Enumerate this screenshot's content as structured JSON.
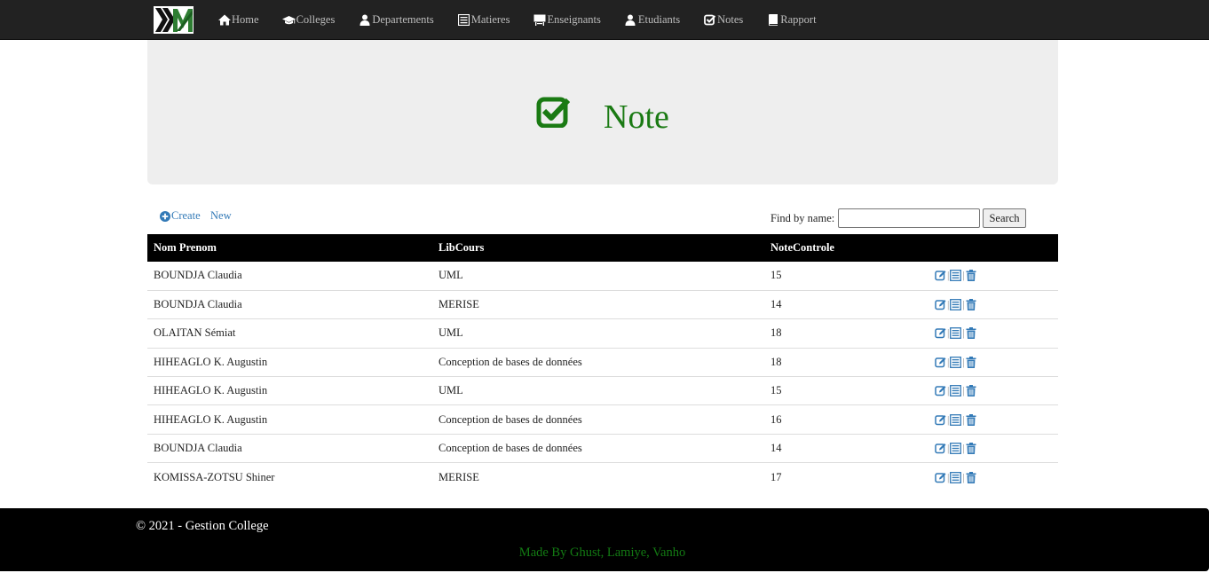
{
  "brand": {
    "alt": "KM"
  },
  "nav": {
    "items": [
      {
        "label": "Home",
        "icon": "home-icon"
      },
      {
        "label": "Colleges",
        "icon": "graduation-cap-icon"
      },
      {
        "label": "Departements",
        "icon": "user-icon"
      },
      {
        "label": "Matieres",
        "icon": "list-alt-icon"
      },
      {
        "label": "Enseignants",
        "icon": "blackboard-icon"
      },
      {
        "label": "Etudiants",
        "icon": "user-icon"
      },
      {
        "label": "Notes",
        "icon": "check-icon"
      },
      {
        "label": "Rapport",
        "icon": "book-icon"
      }
    ]
  },
  "header": {
    "title": "Note",
    "icon": "check-icon",
    "color": "#1a7a13"
  },
  "toolbar": {
    "create_label": "Create",
    "new_label": "New",
    "find_label": "Find by name:",
    "search_value": "",
    "search_button": "Search"
  },
  "table": {
    "columns": [
      "Nom Prenom",
      "LibCours",
      "NoteControle",
      ""
    ],
    "rows": [
      {
        "nom": "BOUNDJA Claudia",
        "cours": "UML",
        "note": "15"
      },
      {
        "nom": "BOUNDJA Claudia",
        "cours": "MERISE",
        "note": "14"
      },
      {
        "nom": "OLAITAN Sémiat",
        "cours": "UML",
        "note": "18"
      },
      {
        "nom": "HIHEAGLO K. Augustin",
        "cours": "Conception de bases de données",
        "note": "18"
      },
      {
        "nom": "HIHEAGLO K. Augustin",
        "cours": "UML",
        "note": "15"
      },
      {
        "nom": "HIHEAGLO K. Augustin",
        "cours": "Conception de bases de données",
        "note": "16"
      },
      {
        "nom": "BOUNDJA Claudia",
        "cours": "Conception de bases de données",
        "note": "14"
      },
      {
        "nom": "KOMISSA-ZOTSU Shiner",
        "cours": "MERISE",
        "note": "17"
      }
    ],
    "action_icons": [
      "edit-icon",
      "details-icon",
      "delete-icon"
    ],
    "action_color": "#337ab7"
  },
  "footer": {
    "copyright": "© 2021 - Gestion College",
    "made_by": "Made By Ghust, Lamiye, Vanho",
    "made_by_color": "#137a13"
  }
}
